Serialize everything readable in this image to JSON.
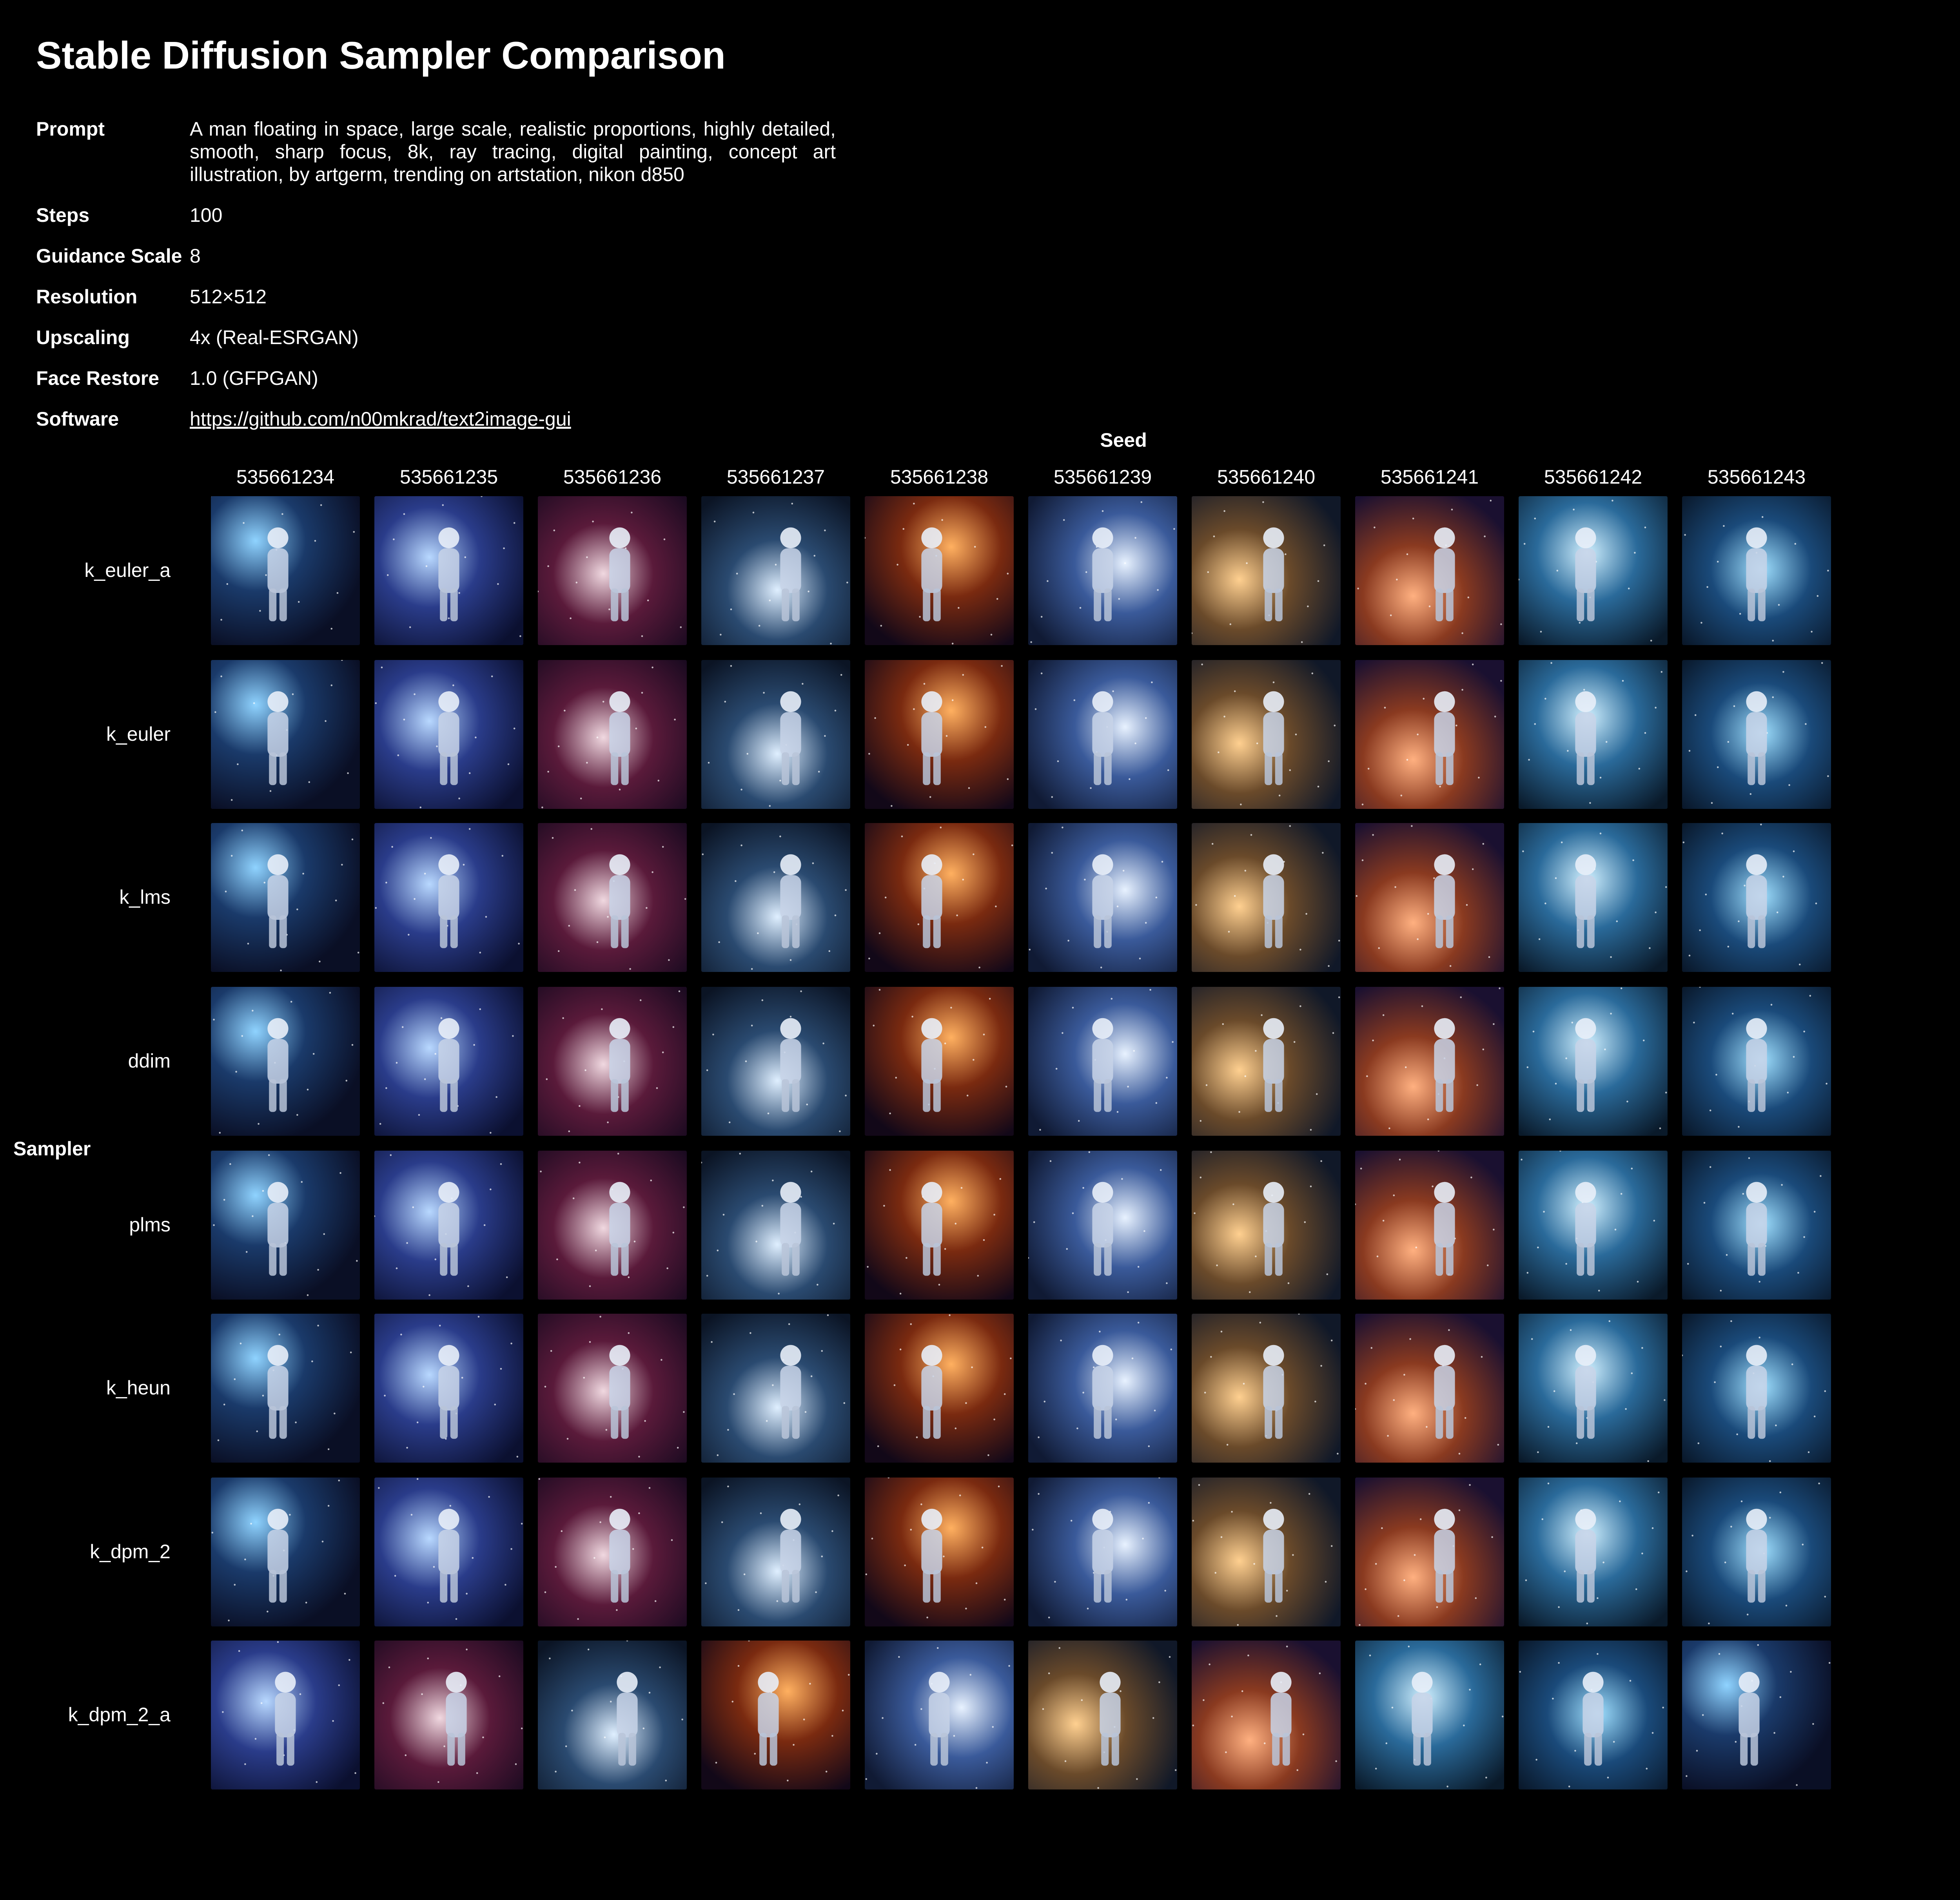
{
  "title": "Stable Diffusion Sampler Comparison",
  "params": [
    {
      "key": "Prompt",
      "value": "A man floating in space, large scale, realistic proportions, highly detailed, smooth, sharp focus, 8k, ray tracing, digital painting, concept art illustration, by artgerm, trending on artstation, nikon d850"
    },
    {
      "key": "Steps",
      "value": "100"
    },
    {
      "key": "Guidance Scale",
      "value": "8"
    },
    {
      "key": "Resolution",
      "value": "512×512"
    },
    {
      "key": "Upscaling",
      "value": "4x (Real-ESRGAN)"
    },
    {
      "key": "Face Restore",
      "value": "1.0 (GFPGAN)"
    },
    {
      "key": "Software",
      "value": "https://github.com/n00mkrad/text2image-gui"
    }
  ],
  "grid": {
    "column_header": "Seed",
    "row_header": "Sampler",
    "seeds": [
      "535661234",
      "535661235",
      "535661236",
      "535661237",
      "535661238",
      "535661239",
      "535661240",
      "535661241",
      "535661242",
      "535661243"
    ],
    "samplers": [
      "k_euler_a",
      "k_euler",
      "k_lms",
      "ddim",
      "plms",
      "k_heun",
      "k_dpm_2",
      "k_dpm_2_a"
    ]
  },
  "colors": {
    "background": "#000000",
    "text": "#ffffff"
  }
}
